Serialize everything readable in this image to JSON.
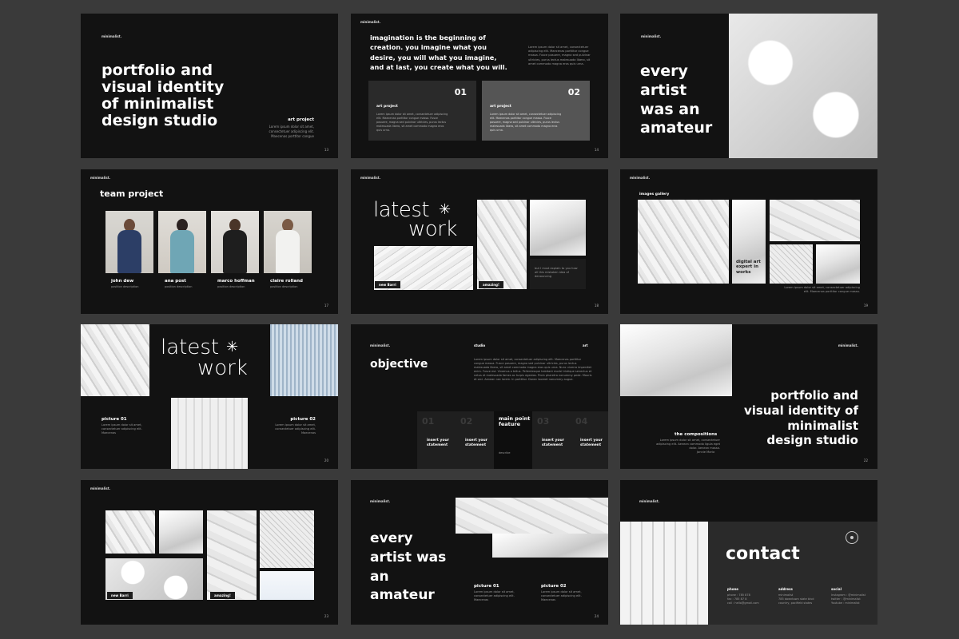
{
  "brand": "minimalist.",
  "s1": {
    "title": "portfolio and visual identity of minimalist design studio",
    "project_label": "art project",
    "project_desc": "Lorem ipsum dolor sit amet, consectetuer adipiscing elit. Maecenas porttitor congue",
    "page": "13"
  },
  "s2": {
    "quote": "imagination is the beginning of creation. you imagine what you desire, you will what you imagine, and at last, you create what you will.",
    "intro": "Lorem ipsum dolor sit amet, consectetuer adipiscing elit. Maecenas porttitor congue massa. Fusce posuere, magna sed pulvinar ultricies, purus lectus malesuada libero, sit amet commodo magna eros quis urna.",
    "card1_num": "01",
    "card1_label": "art project",
    "card1_desc": "Lorem ipsum dolor sit amet, consectetuer adipiscing elit. Maecenas porttitor congue massa. Fusce posuere, magna sed pulvinar ultricies, purus lectus malesuada libero, sit amet commodo magna eros quis urna.",
    "card2_num": "02",
    "card2_label": "art project",
    "card2_desc": "Lorem ipsum dolor sit amet, consectetuer adipiscing elit. Maecenas porttitor congue massa. Fusce posuere, magna sed pulvinar ultricies, purus lectus malesuada libero, sit amet commodo magna eros quis urna.",
    "page": "14"
  },
  "s3": {
    "title": "every artist was an amateur"
  },
  "s4": {
    "title": "team project",
    "members": [
      {
        "name": "john dew",
        "role": "position description"
      },
      {
        "name": "ana post",
        "role": "position description"
      },
      {
        "name": "marco hoffman",
        "role": "position description"
      },
      {
        "name": "claire rolland",
        "role": "position description"
      }
    ],
    "page": "17"
  },
  "s5": {
    "title_a": "latest",
    "title_b": "work",
    "star": "✳",
    "tag1": "new Barri",
    "tag2": "amazing!",
    "caption": "but I must explain to you how all this mistaken idea of denouncing",
    "page": "18"
  },
  "s6": {
    "label": "images gallery",
    "caption_big": "digital art expert in works",
    "caption_small": "Lorem ipsum dolor sit amet, consectetuer adipiscing elit. Maecenas porttitor congue massa.",
    "page": "19"
  },
  "s7": {
    "title_a": "latest",
    "title_b": "work",
    "star": "✳",
    "pic1_label": "picture 01",
    "pic1_desc": "Lorem ipsum dolor sit amet, consectetuer adipiscing elit. Maecenas",
    "pic2_label": "picture 02",
    "pic2_desc": "Lorem ipsum dolor sit amet, consectetuer adipiscing elit. Maecenas",
    "page": "20"
  },
  "s8": {
    "nav_studio": "studio",
    "nav_art": "art",
    "title": "objective",
    "body": "Lorem ipsum dolor sit amet, consectetuer adipiscing elit. Maecenas porttitor congue massa. Fusce posuere, magna sed pulvinar ultricies, purus lectus malesuada libero, sit amet commodo magna eros quis urna. Nunc viverra imperdiet enim. Fusce est. Vivamus a tellus. Pellentesque habitant morbi tristique senectus et netus et malesuada fames ac turpis egestas. Proin pharetra nonummy pede. Mauris et orci. Aenean nec lorem. In porttitor. Donec laoreet nonummy augue.",
    "statements": [
      {
        "num": "01",
        "text": "insert your statement"
      },
      {
        "num": "02",
        "text": "insert your statement"
      },
      {
        "num": "03",
        "text": "insert your statement"
      },
      {
        "num": "04",
        "text": "insert your statement"
      }
    ],
    "main_title": "main point feature",
    "main_sub": "describe"
  },
  "s9": {
    "title": "portfolio and visual identity of minimalist design studio",
    "label": "the compositions",
    "desc": "Lorem ipsum dolor sit amet, consectetuer adipiscing elit. Aenean commodo ligula eget dolor. Aenean massa.",
    "sig": "Jonnie Maria",
    "page": "22"
  },
  "s10": {
    "tag1": "new Barri",
    "tag2": "amazing!",
    "page": "23"
  },
  "s11": {
    "title": "every artist was an amateur",
    "pic1_label": "picture 01",
    "pic1_desc": "Lorem ipsum dolor sit amet, consectetuer adipiscing elit. Maecenas",
    "pic2_label": "picture 02",
    "pic2_desc": "Lorem ipsum dolor sit amet, consectetuer adipiscing elit. Maecenas",
    "page": "24"
  },
  "s12": {
    "title": "contact",
    "phone_label": "phone",
    "phone_lines": "phone : 785 878\nfax : 785 87 8\ncall : hello@gmail.com",
    "address_label": "address",
    "address_lines": "minimalist\n785 downtown state blvd\ncountry, pacifield states",
    "social_label": "social",
    "social_lines": "Instagram : @minimalist\ntwitter : @minimalist\nYoutube : minimalist"
  },
  "colors": {
    "background": "#3a3a3a",
    "slide": "#121212",
    "card_dark": "#2a2a2a",
    "card_light": "#555555",
    "text": "#ffffff"
  }
}
